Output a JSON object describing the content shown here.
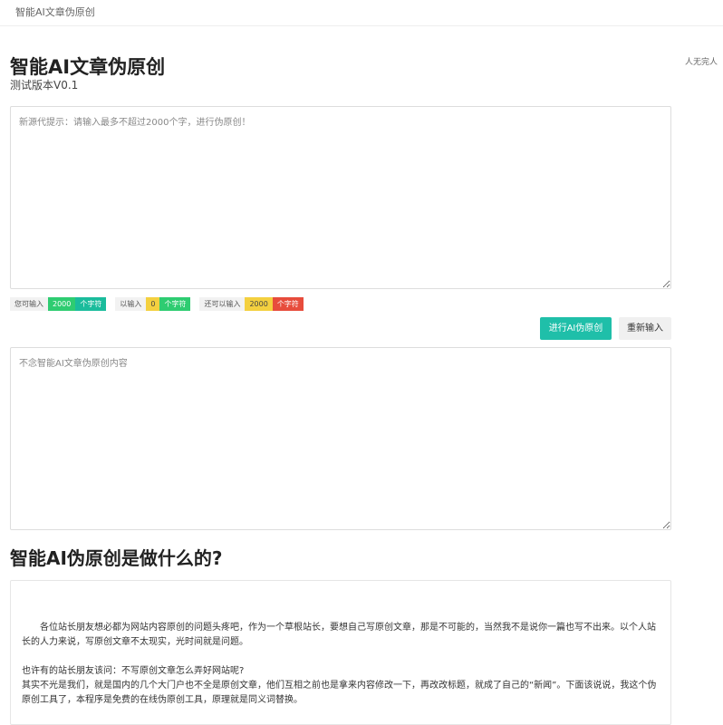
{
  "topbar": {
    "brand": "智能AI文章伪原创"
  },
  "side_note": "人无完人",
  "header": {
    "title": "智能AI文章伪原创",
    "subtitle": "测试版本V0.1"
  },
  "source_box": {
    "placeholder": "新源代提示：请输入最多不超过2000个字，进行伪原创！"
  },
  "counters": {
    "allowed": {
      "label": "您可输入",
      "value": "2000",
      "unit": "个字符"
    },
    "entered": {
      "label": "以输入",
      "value": "0",
      "unit": "个字符"
    },
    "remaining": {
      "label": "还可以输入",
      "value": "2000",
      "unit": "个字符"
    }
  },
  "buttons": {
    "rewrite": "进行AI伪原创",
    "reset": "重新输入"
  },
  "output_box": {
    "placeholder": "不念智能AI文章伪原创内容"
  },
  "article": {
    "heading": "智能AI伪原创是做什么的?",
    "paragraph1": "各位站长朋友想必都为网站内容原创的问题头疼吧，作为一个草根站长，要想自己写原创文章，那是不可能的，当然我不是说你一篇也写不出来。以个人站长的人力来说，写原创文章不太现实，光时间就是问题。",
    "paragraph2": "也许有的站长朋友该问：不写原创文章怎么弄好网站呢?",
    "paragraph3": "其实不光是我们，就是国内的几个大门户也不全是原创文章，他们互相之前也是拿来内容修改一下，再改改标题，就成了自己的“新闻”。下面该说说，我这个伪原创工具了，本程序是免费的在线伪原创工具，原理就是同义词替换。"
  }
}
